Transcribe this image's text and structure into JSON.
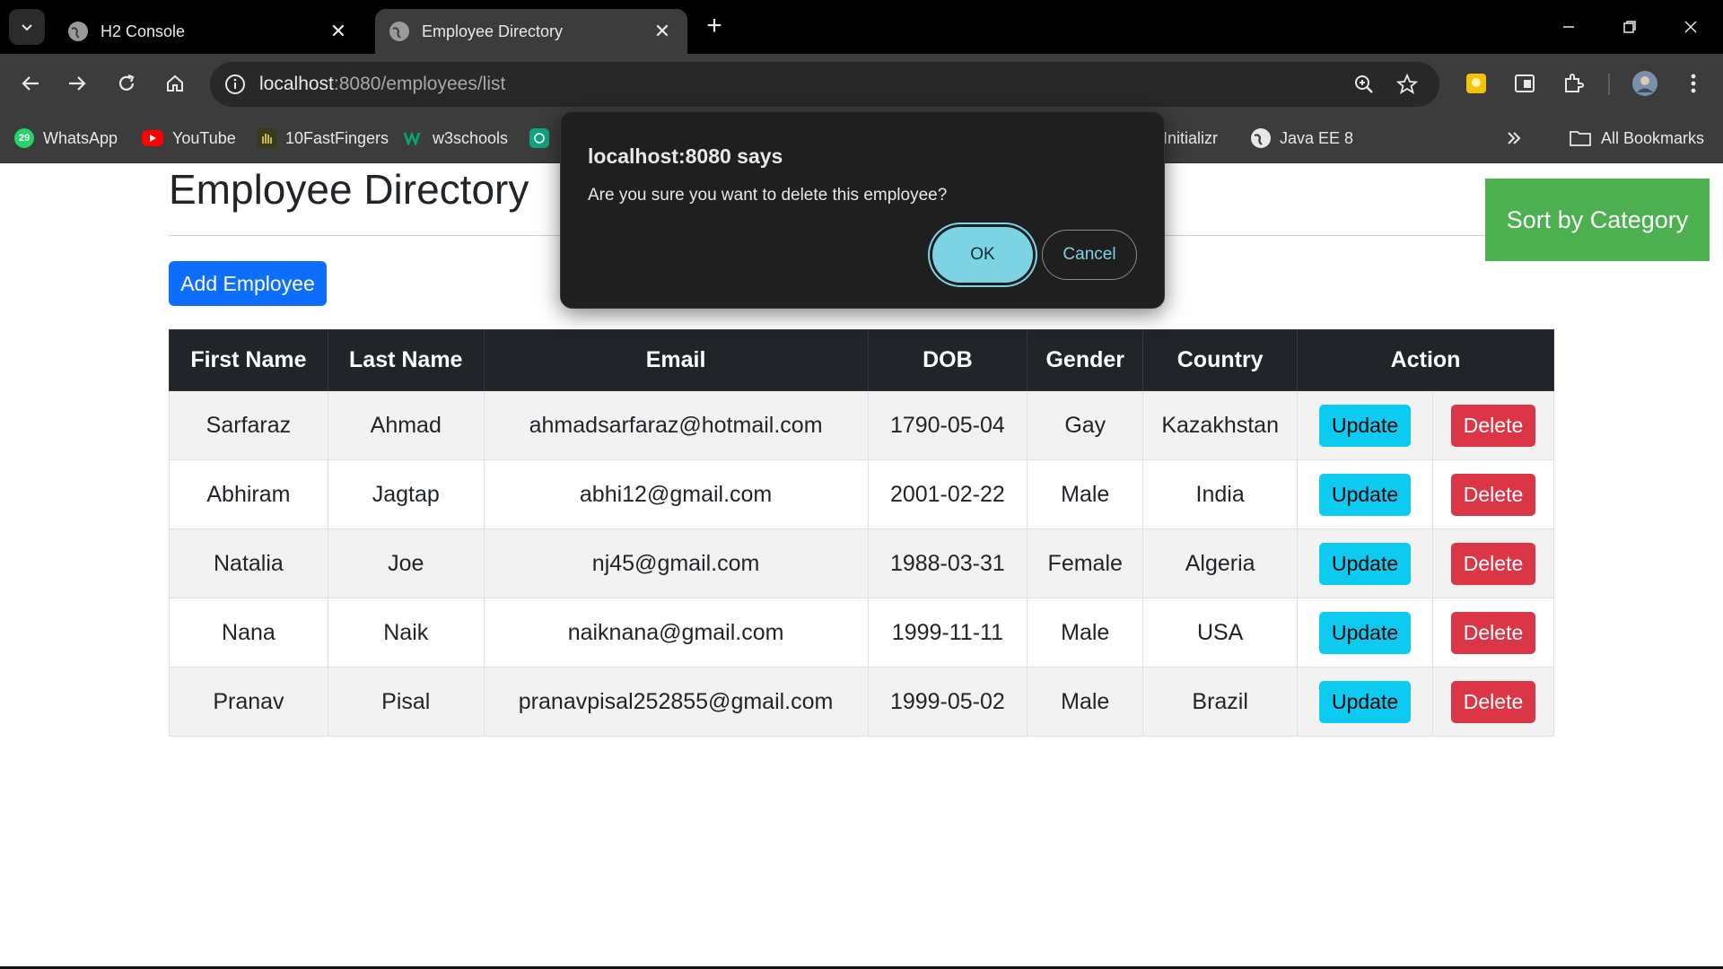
{
  "browser": {
    "tabs": [
      {
        "title": "H2 Console",
        "active": false
      },
      {
        "title": "Employee Directory",
        "active": true
      }
    ],
    "url_host": "localhost",
    "url_path": ":8080/employees/list",
    "bookmarks": [
      {
        "label": "WhatsApp",
        "icon": "whatsapp-icon",
        "badge": "29"
      },
      {
        "label": "YouTube",
        "icon": "youtube-icon"
      },
      {
        "label": "10FastFingers",
        "icon": "10fastfingers-icon"
      },
      {
        "label": "w3schools",
        "icon": "w3schools-icon"
      },
      {
        "label": "Initializr",
        "icon": "spring-initializr-icon"
      },
      {
        "label": "Java EE 8",
        "icon": "globe-icon"
      }
    ],
    "all_bookmarks_label": "All Bookmarks"
  },
  "page": {
    "title": "Employee Directory",
    "sort_button": "Sort by Category",
    "add_button": "Add Employee",
    "table": {
      "headers": [
        "First Name",
        "Last Name",
        "Email",
        "DOB",
        "Gender",
        "Country",
        "Action"
      ],
      "rows": [
        [
          "Sarfaraz",
          "Ahmad",
          "ahmadsarfaraz@hotmail.com",
          "1790-05-04",
          "Gay",
          "Kazakhstan"
        ],
        [
          "Abhiram",
          "Jagtap",
          "abhi12@gmail.com",
          "2001-02-22",
          "Male",
          "India"
        ],
        [
          "Natalia",
          "Joe",
          "nj45@gmail.com",
          "1988-03-31",
          "Female",
          "Algeria"
        ],
        [
          "Nana",
          "Naik",
          "naiknana@gmail.com",
          "1999-11-11",
          "Male",
          "USA"
        ],
        [
          "Pranav",
          "Pisal",
          "pranavpisal252855@gmail.com",
          "1999-05-02",
          "Male",
          "Brazil"
        ]
      ],
      "update_label": "Update",
      "delete_label": "Delete"
    }
  },
  "dialog": {
    "title": "localhost:8080 says",
    "message": "Are you sure you want to delete this employee?",
    "ok_label": "OK",
    "cancel_label": "Cancel"
  },
  "colors": {
    "add_button": "#0d6efd",
    "sort_button": "#4caf50",
    "update_button": "#0dcaf0",
    "delete_button": "#dc3545",
    "table_header": "#212529",
    "dialog_accent": "#7cd3e4"
  }
}
